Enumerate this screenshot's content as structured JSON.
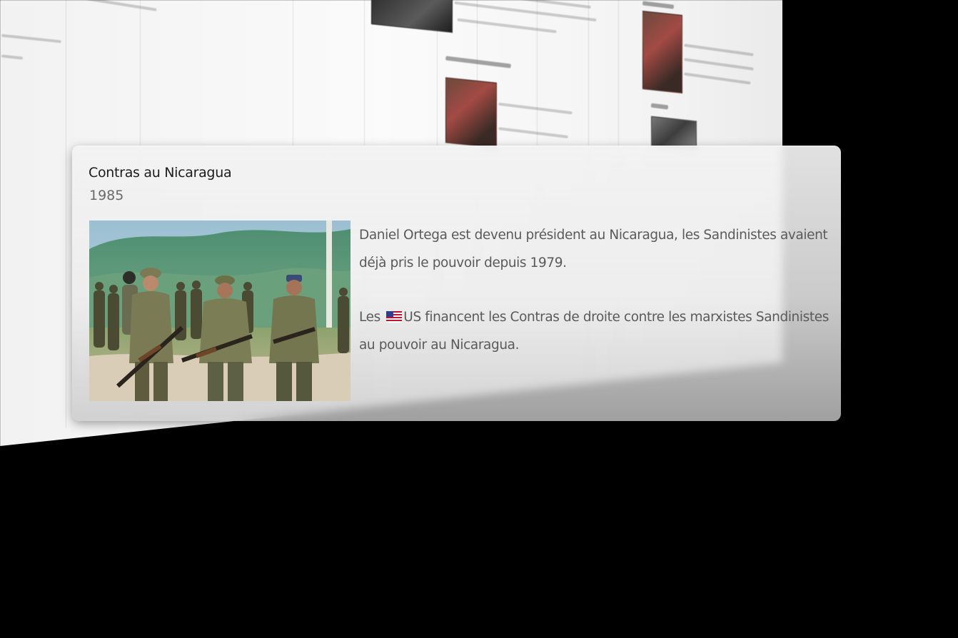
{
  "card": {
    "title": "Contras au Nicaragua",
    "year": "1985",
    "photo_alt": "Contra soldiers with rifles in a jungle clearing",
    "paragraph1": "Daniel Ortega est devenu président au Nicaragua, les Sandinistes avaient déjà pris le pouvoir depuis 1979.",
    "paragraph2_before_flag": "Les ",
    "flag_icon": "us-flag-icon",
    "paragraph2_after_flag": "US  financent les Contras de droite contre les marxistes Sandinistes au pouvoir au Nicaragua."
  },
  "colors": {
    "background": "#000000",
    "card_bg": "#efefef",
    "title_color": "#1c1c1c",
    "year_color": "#6a6a6a",
    "body_text": "#5a5a5a"
  }
}
